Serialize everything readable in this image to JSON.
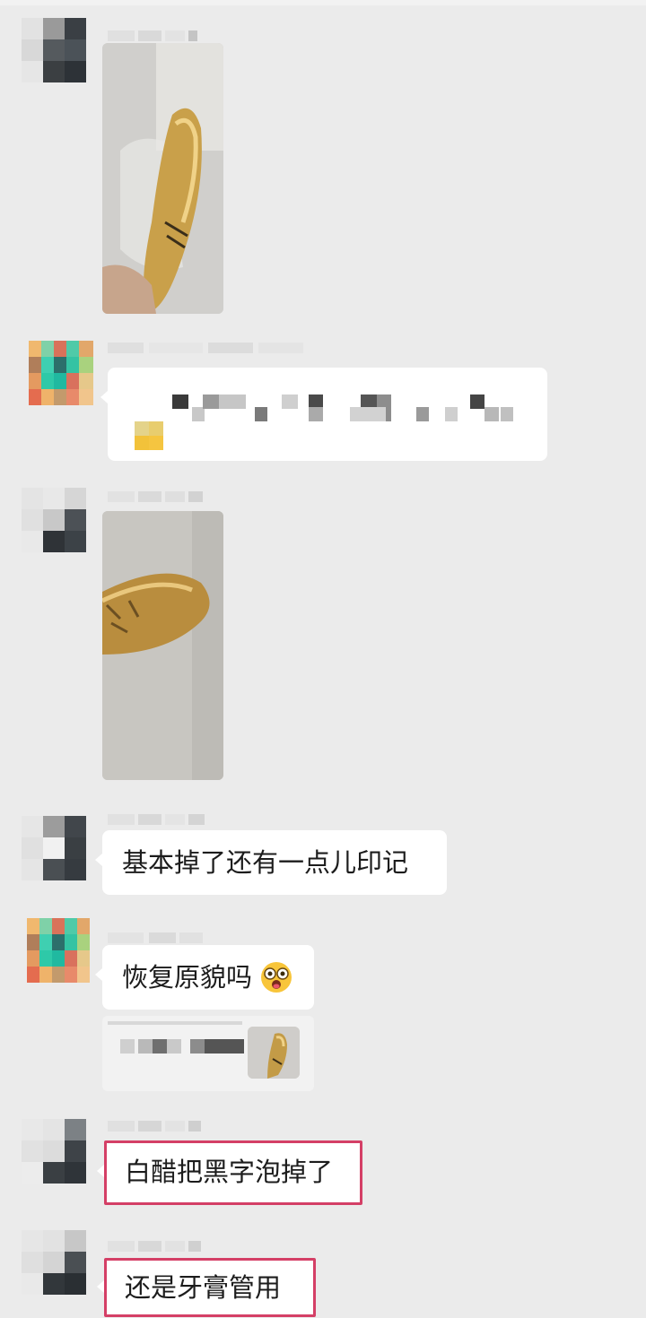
{
  "messages": [
    {
      "kind": "image",
      "sender": "member-a"
    },
    {
      "kind": "text",
      "sender": "member-b",
      "text": ""
    },
    {
      "kind": "image",
      "sender": "member-a"
    },
    {
      "kind": "text",
      "sender": "member-a",
      "text": "基本掉了还有一点儿印记"
    },
    {
      "kind": "text",
      "sender": "member-b",
      "text": "恢复原貌吗",
      "emoji": "surprised-face"
    },
    {
      "kind": "quote",
      "sender": "member-b"
    },
    {
      "kind": "text",
      "sender": "member-a",
      "text": "白醋把黑字泡掉了",
      "highlighted": true
    },
    {
      "kind": "text",
      "sender": "member-a",
      "text": "还是牙膏管用",
      "highlighted": true
    }
  ],
  "colors": {
    "background": "#ebebeb",
    "bubble": "#ffffff",
    "highlight_border": "#d43f66",
    "gold": "#c9a04a"
  },
  "icons": {
    "emoji": "surprised-face-emoji-icon"
  }
}
